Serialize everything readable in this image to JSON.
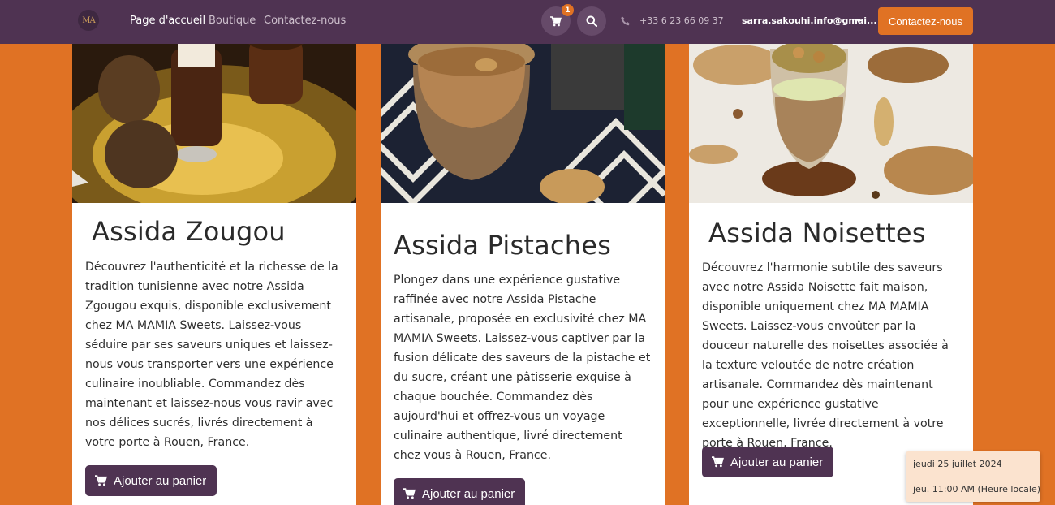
{
  "navbar": {
    "logo_text": "MA",
    "links": [
      {
        "label": "Page d'accueil",
        "active": true
      },
      {
        "label": "Boutique",
        "active": false
      },
      {
        "label": "Contactez-nous",
        "active": false
      }
    ],
    "cart_count": "1",
    "phone": "+33 6 23 66 09 37",
    "account": "sarra.sakouhi.info@gmai...",
    "contact_button": "Contactez-nous",
    "icons": [
      "cart-icon",
      "search-icon",
      "phone-icon",
      "chevron-down-icon"
    ],
    "colors": {
      "bar": "#4f3352",
      "accent": "#e07224"
    }
  },
  "products": [
    {
      "title": "Assida Zougou",
      "description": "Découvrez l'authenticité et la richesse de la tradition tunisienne avec notre Assida Zgougou exquis, disponible exclusivement chez MA MAMIA Sweets. Laissez-vous séduire par ses saveurs uniques et laissez-nous vous transporter vers une expérience culinaire inoubliable. Commandez dès maintenant et laissez-nous vous ravir avec nos délices sucrés, livrés directement à votre porte à Rouen, France.",
      "button": "Ajouter au panier"
    },
    {
      "title": "Assida Pistaches",
      "description": "Plongez dans une expérience gustative raffinée avec notre Assida Pistache artisanale, proposée en exclusivité chez MA MAMIA Sweets. Laissez-vous captiver par la fusion délicate des saveurs de la pistache et du sucre, créant une pâtisserie exquise à chaque bouchée. Commandez dès aujourd'hui et offrez-vous un voyage culinaire authentique, livré directement chez vous à Rouen, France.",
      "button": "Ajouter au panier"
    },
    {
      "title": "Assida Noisettes",
      "description": "Découvrez l'harmonie subtile des saveurs avec notre Assida Noisette fait maison, disponible uniquement chez MA MAMIA Sweets. Laissez-vous envoûter par la douceur naturelle des noisettes associée à la texture veloutée de notre création artisanale. Commandez dès maintenant pour une expérience gustative exceptionnelle, livrée directement à votre porte à Rouen, France.",
      "button": "Ajouter au panier"
    }
  ],
  "datetime": {
    "date": "jeudi 25 juillet 2024",
    "time": "jeu. 11:00 AM (Heure locale)"
  }
}
